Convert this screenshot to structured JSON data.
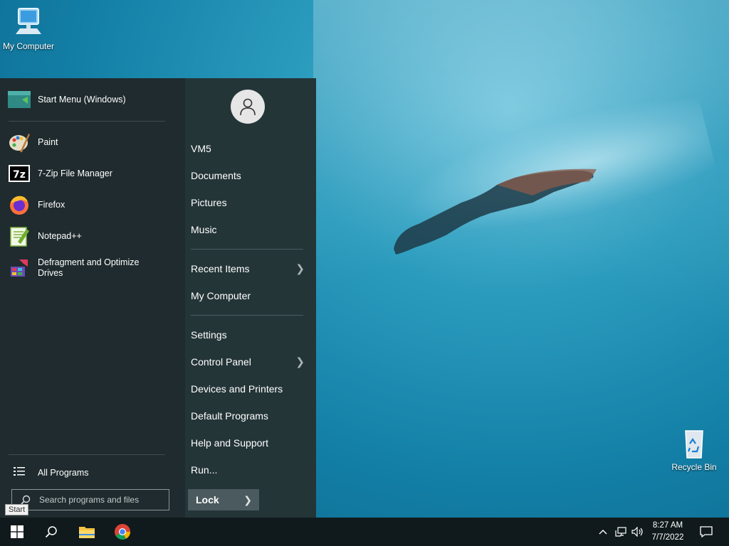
{
  "desktop": {
    "my_computer": "My Computer",
    "recycle_bin": "Recycle Bin"
  },
  "start_menu": {
    "header": "Start Menu (Windows)",
    "programs": [
      {
        "label": "Paint",
        "icon": "paint-icon"
      },
      {
        "label": "7-Zip File Manager",
        "icon": "7zip-icon"
      },
      {
        "label": "Firefox",
        "icon": "firefox-icon"
      },
      {
        "label": "Notepad++",
        "icon": "notepad-plus-plus-icon"
      },
      {
        "label": "Defragment and Optimize Drives",
        "icon": "defrag-icon"
      }
    ],
    "all_programs": "All Programs",
    "search_placeholder": "Search programs and files",
    "right": {
      "user": "VM5",
      "documents": "Documents",
      "pictures": "Pictures",
      "music": "Music",
      "recent_items": "Recent Items",
      "my_computer": "My Computer",
      "settings": "Settings",
      "control_panel": "Control Panel",
      "devices_printers": "Devices and Printers",
      "default_programs": "Default Programs",
      "help_support": "Help and Support",
      "run": "Run...",
      "lock": "Lock"
    }
  },
  "tooltip": "Start",
  "taskbar": {
    "time": "8:27 AM",
    "date": "7/7/2022"
  },
  "colors": {
    "menu_left": "#1f2b2e",
    "menu_right": "#243538",
    "taskbar": "#101a1c"
  }
}
